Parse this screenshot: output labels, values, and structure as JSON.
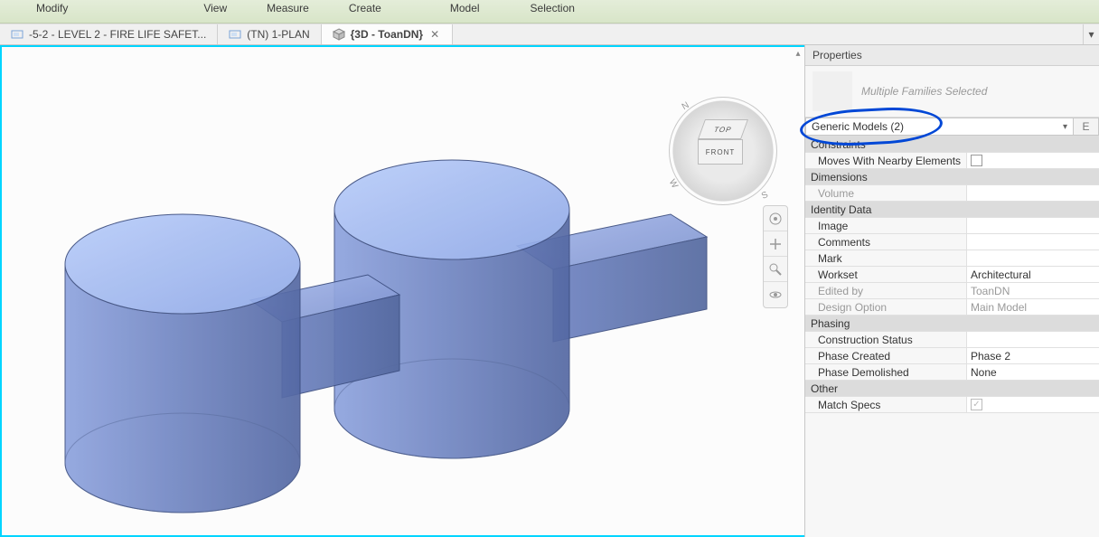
{
  "ribbon": {
    "items_left": [
      "Modify"
    ],
    "items_mid": [
      "View",
      "Measure",
      "Create"
    ],
    "items_right": [
      "Model",
      "Selection"
    ]
  },
  "tabs": {
    "t1": "-5-2 - LEVEL 2 - FIRE LIFE SAFET...",
    "t2": "(TN) 1-PLAN",
    "t3": "{3D - ToanDN}",
    "close": "✕",
    "overflow": "▾"
  },
  "viewcube": {
    "top": "TOP",
    "front": "FRONT",
    "n": "N",
    "s": "S",
    "w": "W"
  },
  "properties": {
    "title": "Properties",
    "type_label": "Multiple Families Selected",
    "filter": "Generic Models (2)",
    "edit_type_icon": "E",
    "groups": {
      "constraints": {
        "header": "Constraints",
        "moves_label": "Moves With Nearby Elements"
      },
      "dimensions": {
        "header": "Dimensions",
        "volume_label": "Volume"
      },
      "identity": {
        "header": "Identity Data",
        "image_label": "Image",
        "comments_label": "Comments",
        "mark_label": "Mark",
        "workset_label": "Workset",
        "workset_value": "Architectural",
        "editedby_label": "Edited by",
        "editedby_value": "ToanDN",
        "designopt_label": "Design Option",
        "designopt_value": "Main Model"
      },
      "phasing": {
        "header": "Phasing",
        "cstatus_label": "Construction Status",
        "created_label": "Phase Created",
        "created_value": "Phase 2",
        "demolished_label": "Phase Demolished",
        "demolished_value": "None"
      },
      "other": {
        "header": "Other",
        "match_label": "Match Specs"
      }
    }
  }
}
